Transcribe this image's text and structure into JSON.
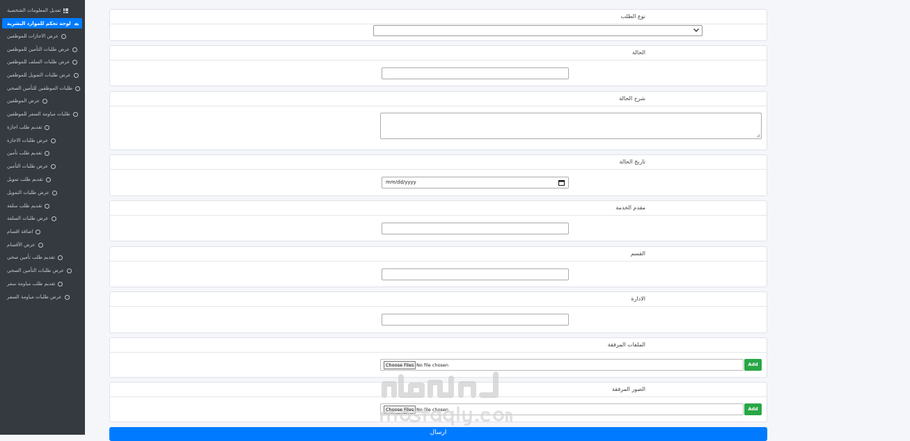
{
  "sidebar": {
    "items": [
      {
        "label": "تعديل المعلومات الشخصية",
        "icon": "grid-icon",
        "active": false
      },
      {
        "label": "لوحة تحكم للموارد البشرية",
        "icon": "dashboard-icon",
        "active": true
      },
      {
        "label": "عرض الاجازات للموظفين",
        "icon": "circle-icon"
      },
      {
        "label": "عرض طلبات التأمين للموظفين",
        "icon": "circle-icon"
      },
      {
        "label": "عرض طلبات السلف للموظفين",
        "icon": "circle-icon"
      },
      {
        "label": "عرض طلبات التمويل للموظفين",
        "icon": "circle-icon"
      },
      {
        "label": "طلبات الموظفين للتأمين الصحي",
        "icon": "circle-icon"
      },
      {
        "label": "عرض الموظفين",
        "icon": "circle-icon"
      },
      {
        "label": "طلبات مياومة السفر للموظفين",
        "icon": "circle-icon"
      },
      {
        "label": "تقديم طلب اجازة",
        "icon": "circle-icon"
      },
      {
        "label": "عرض طلبات الاجازة",
        "icon": "circle-icon"
      },
      {
        "label": "تقديم طلب تأمين",
        "icon": "circle-icon"
      },
      {
        "label": "عرض طلبات التأمين",
        "icon": "circle-icon"
      },
      {
        "label": "تقديم طلب تمويل",
        "icon": "circle-icon"
      },
      {
        "label": "عرض طلبات التمويل",
        "icon": "circle-icon"
      },
      {
        "label": "تقديم طلب سلفة",
        "icon": "circle-icon"
      },
      {
        "label": "عرض طلبات السلفة",
        "icon": "circle-icon"
      },
      {
        "label": "اضافة اقسام",
        "icon": "circle-icon"
      },
      {
        "label": "عرض الأقسام",
        "icon": "circle-icon"
      },
      {
        "label": "تقديم طلب تأمين صحي",
        "icon": "circle-icon"
      },
      {
        "label": "عرض طلبات التأمين الصحي",
        "icon": "circle-icon"
      },
      {
        "label": "تقديم طلب مياومة سفر",
        "icon": "circle-icon"
      },
      {
        "label": "عرض طلبات مياومة السفر",
        "icon": "circle-icon"
      }
    ]
  },
  "form": {
    "request_type": {
      "label": "نوع الطلب",
      "value": ""
    },
    "status": {
      "label": "الحالة",
      "value": ""
    },
    "status_description": {
      "label": "شرح الحالة",
      "value": ""
    },
    "status_date": {
      "label": "تاريخ الحالة",
      "placeholder": "mm/dd/yyyy"
    },
    "service_provider": {
      "label": "مقدم الخدمة",
      "value": ""
    },
    "department": {
      "label": "القسم",
      "value": ""
    },
    "administration": {
      "label": "الادارة",
      "value": ""
    },
    "attached_files": {
      "label": "الملفات المرفقة",
      "choose_label": "Choose Files",
      "no_file_label": "No file chosen",
      "add_label": "Add"
    },
    "attached_images": {
      "label": "الصور المرفقة",
      "choose_label": "Choose Files",
      "no_file_label": "No file chosen",
      "add_label": "Add"
    },
    "submit_label": "ارسال"
  },
  "colors": {
    "sidebar_bg": "#343a40",
    "primary": "#007bff",
    "success": "#28a745"
  },
  "watermark": {
    "text": "mostaql.com"
  }
}
